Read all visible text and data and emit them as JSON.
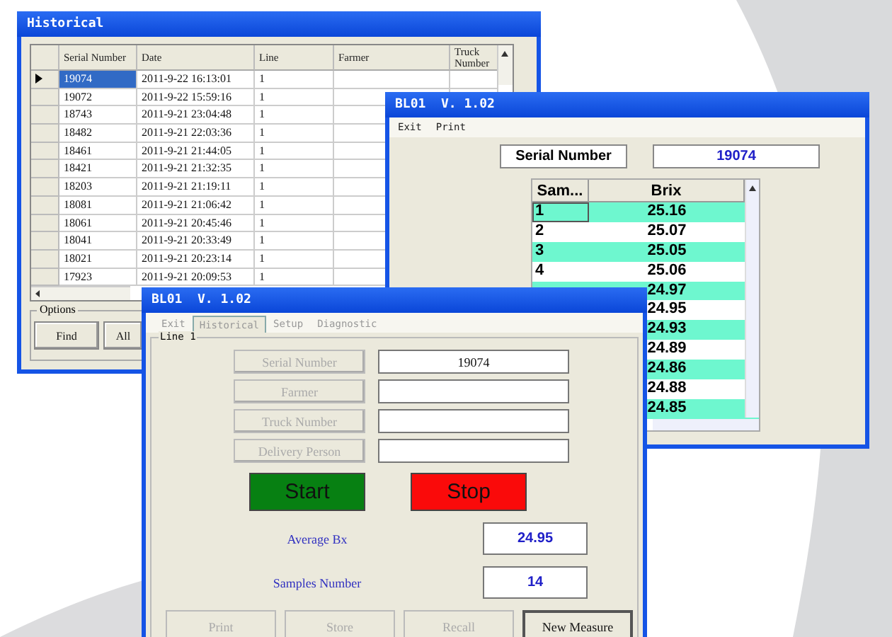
{
  "historical_window": {
    "title": "Historical",
    "table": {
      "columns": [
        "Serial Number",
        "Date",
        "Line",
        "Farmer",
        "Truck Number"
      ],
      "rows": [
        {
          "selected": true,
          "cells": [
            "19074",
            "2011-9-22 16:13:01",
            "1"
          ]
        },
        {
          "selected": false,
          "cells": [
            "19072",
            "2011-9-22 15:59:16",
            "1"
          ]
        },
        {
          "selected": false,
          "cells": [
            "18743",
            "2011-9-21 23:04:48",
            "1"
          ]
        },
        {
          "selected": false,
          "cells": [
            "18482",
            "2011-9-21 22:03:36",
            "1"
          ]
        },
        {
          "selected": false,
          "cells": [
            "18461",
            "2011-9-21 21:44:05",
            "1"
          ]
        },
        {
          "selected": false,
          "cells": [
            "18421",
            "2011-9-21 21:32:35",
            "1"
          ]
        },
        {
          "selected": false,
          "cells": [
            "18203",
            "2011-9-21 21:19:11",
            "1"
          ]
        },
        {
          "selected": false,
          "cells": [
            "18081",
            "2011-9-21 21:06:42",
            "1"
          ]
        },
        {
          "selected": false,
          "cells": [
            "18061",
            "2011-9-21 20:45:46",
            "1"
          ]
        },
        {
          "selected": false,
          "cells": [
            "18041",
            "2011-9-21 20:33:49",
            "1"
          ]
        },
        {
          "selected": false,
          "cells": [
            "18021",
            "2011-9-21 20:23:14",
            "1"
          ]
        },
        {
          "selected": false,
          "cells": [
            "17923",
            "2011-9-21 20:09:53",
            "1"
          ]
        }
      ]
    },
    "options": {
      "label": "Options",
      "buttons": [
        "Find",
        "All"
      ]
    }
  },
  "samples_window": {
    "title": "BL01  V. 1.02",
    "menu": [
      "Exit",
      "Print"
    ],
    "serial": {
      "label": "Serial Number",
      "value": "19074"
    },
    "table": {
      "columns": [
        "Sam...",
        "Brix"
      ],
      "rows": [
        {
          "sample": "1",
          "brix": "25.16",
          "selected": true
        },
        {
          "sample": "2",
          "brix": "25.07",
          "selected": false
        },
        {
          "sample": "3",
          "brix": "25.05",
          "selected": false
        },
        {
          "sample": "4",
          "brix": "25.06",
          "selected": false
        },
        {
          "brix": "24.97",
          "selected": false
        },
        {
          "brix": "24.95",
          "selected": false
        },
        {
          "brix": "24.93",
          "selected": false
        },
        {
          "brix": "24.89",
          "selected": false
        },
        {
          "brix": "24.86",
          "selected": false
        },
        {
          "brix": "24.88",
          "selected": false
        },
        {
          "brix": "24.85",
          "selected": false
        }
      ]
    }
  },
  "measure_window": {
    "title": "BL01  V. 1.02",
    "tabs": [
      {
        "label": "Exit",
        "selected": false
      },
      {
        "label": "Historical",
        "selected": true
      },
      {
        "label": "Setup",
        "selected": false
      },
      {
        "label": "Diagnostic",
        "selected": false
      }
    ],
    "group_label": "Line 1",
    "fields": [
      {
        "label": "Serial Number",
        "disabled": true,
        "value": "19074"
      },
      {
        "label": "Farmer",
        "disabled": true
      },
      {
        "label": "Truck Number",
        "disabled": true
      },
      {
        "label": "Delivery Person",
        "disabled": true
      }
    ],
    "actions": [
      {
        "label": "Start",
        "color": "#078012"
      },
      {
        "label": "Stop",
        "color": "#fa0a0a"
      }
    ],
    "readings": [
      {
        "label": "Average Bx",
        "value": "24.95"
      },
      {
        "label": "Samples Number",
        "value": "14"
      }
    ],
    "buttons": [
      {
        "label": "Print",
        "disabled": true
      },
      {
        "label": "Store",
        "disabled": true
      },
      {
        "label": "Recall",
        "disabled": true
      },
      {
        "label": "New Measure",
        "disabled": false
      }
    ]
  }
}
